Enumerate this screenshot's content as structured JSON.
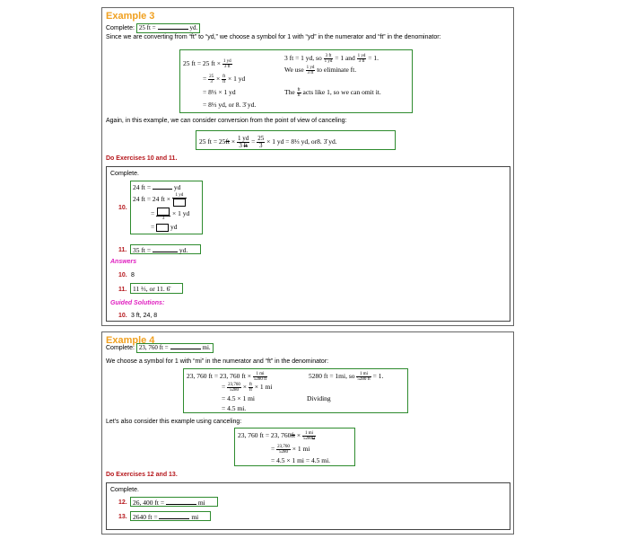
{
  "example3": {
    "title": "Example 3",
    "complete_prefix": "Complete:",
    "problem_lhs": "25 ft =",
    "problem_unit": "yd.",
    "explanation": "Since we are converting from “ft” to “yd,” we choose a symbol for 1 with “yd” in the numerator and “ft” in the denominator:",
    "work": {
      "l1_a": "25 ft = 25 ft ×",
      "f_1yd": "1 yd",
      "f_3ft": "3 ft",
      "r1": "3 ft = 1 yd, so",
      "r1_mid": "= 1 and",
      "r1_end": "= 1.",
      "r2_a": "We use",
      "r2_b": "to eliminate ft.",
      "l2_eq": "=",
      "f_25": "25",
      "f_3": "3",
      "f_ft": "ft",
      "l2_tail": "× 1 yd",
      "l3": "= 8⅓ × 1 yd",
      "r3_a": "The",
      "r3_b": "acts like 1, so we can omit it.",
      "l4": "= 8⅓ yd, or 8. 3̄ yd."
    },
    "cancel_intro": "Again, in this example, we can consider conversion from the point of view of canceling:",
    "cancel": {
      "a": "25 ft = 25",
      "ft": "ft",
      "times": "×",
      "num": "1 yd",
      "den": "3",
      "eq2": "=",
      "n25": "25",
      "d3": "3",
      "tail": "× 1 yd = 8⅓ yd,  or8. 3̄ yd."
    },
    "do_exercises": "Do Exercises 10 and 11.",
    "exercises": {
      "intro": "Complete.",
      "ex10_num": "10.",
      "ex10_l1": "24 ft =",
      "ex10_l1_unit": "yd",
      "ex10_l2": "24 ft = 24 ft ×",
      "ex10_l2_num": "1 yd",
      "ex10_l3_tail": "× 1 yd",
      "ex10_l3_den": "3",
      "ex10_l4_unit": "yd",
      "eq": "=",
      "ex11_num": "11.",
      "ex11_lhs": "35 ft =",
      "ex11_unit": "yd.",
      "answers_label": "Answers",
      "ans10_num": "10.",
      "ans10": "8",
      "ans11_num": "11.",
      "ans11": "11 ⅔,  or 11. 6̄",
      "guided_label": "Guided Solutions:",
      "guided10_num": "10.",
      "guided10": "3 ft, 24, 8"
    }
  },
  "example4": {
    "title": "Example 4",
    "complete_prefix": "Complete:",
    "problem_lhs": "23, 760 ft =",
    "problem_unit": "mi.",
    "explanation": "We choose a symbol for 1 with “mi” in the numerator and “ft” in the denominator:",
    "work": {
      "l1": "23, 760 ft = 23, 760 ft ×",
      "f_1mi": "1 mi",
      "f_5280ft": "5280 ft",
      "r1": "5280 ft = 1mi, so",
      "r1_end": "= 1.",
      "l2_eq": "=",
      "f_23760": "23,760",
      "f_5280": "5280",
      "f_ft": "ft",
      "l2_tail": "× 1 mi",
      "l3": "= 4.5 × 1 mi",
      "r3": "Dividing",
      "l4": "= 4.5 mi."
    },
    "cancel_intro": "Let’s also consider this example using canceling:",
    "cancel": {
      "l1": "23, 760 ft = 23, 760",
      "ft": "ft",
      "times": "×",
      "eq": "=",
      "num": "1 mi",
      "den": "5280",
      "l2_tail": "× 1 mi",
      "n23760": "23,760",
      "d5280": "5280",
      "l3": "= 4.5 × 1 mi = 4.5 mi."
    },
    "do_exercises": "Do Exercises 12 and 13.",
    "exercises": {
      "intro": "Complete.",
      "ex12_num": "12.",
      "ex12_lhs": "26, 400 ft =",
      "ex12_unit": "mi",
      "ex13_num": "13.",
      "ex13_lhs": "2640 ft =",
      "ex13_unit": "mi"
    }
  },
  "colors": {
    "title_orange": "#f0a020",
    "exercise_red": "#b5161b",
    "answers_magenta": "#e020c0",
    "box_green": "#2e8b2e"
  }
}
